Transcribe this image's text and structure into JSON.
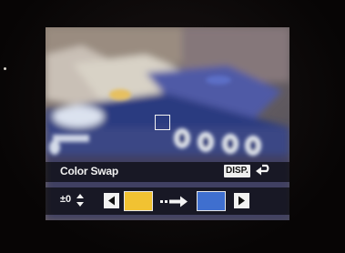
{
  "osd": {
    "mode_label": "Color Swap",
    "disp_label": "DISP.",
    "exposure_value": "±0"
  },
  "swap": {
    "from_color": "#f1c232",
    "to_color": "#3f6fcf"
  },
  "icons": {
    "return": "return-arrow-icon",
    "updown": "up-down-arrows-icon",
    "left": "left-arrow-icon",
    "right": "right-arrow-icon",
    "arrow": "dashed-right-arrow-icon",
    "focus": "focus-frame-icon"
  }
}
